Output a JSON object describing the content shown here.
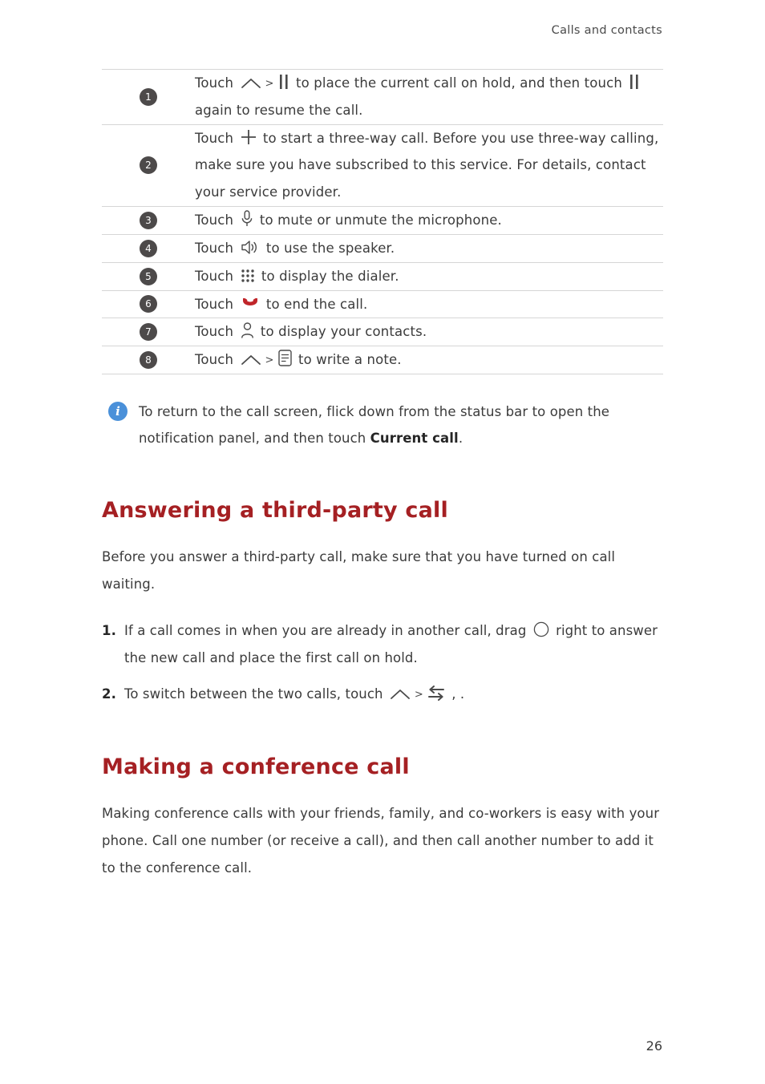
{
  "header": {
    "running_title": "Calls and contacts"
  },
  "table": {
    "rows": [
      {
        "num": "1",
        "seg": [
          {
            "t": "text",
            "v": "Touch "
          },
          {
            "t": "icon",
            "v": "chevron-up-icon"
          },
          {
            "t": "sep",
            "v": ">"
          },
          {
            "t": "icon",
            "v": "pause-icon"
          },
          {
            "t": "text",
            "v": " to place the current call on hold, and then touch "
          },
          {
            "t": "icon",
            "v": "pause-icon"
          },
          {
            "t": "text",
            "v": " again to resume the call."
          }
        ]
      },
      {
        "num": "2",
        "seg": [
          {
            "t": "text",
            "v": "Touch "
          },
          {
            "t": "icon",
            "v": "plus-icon"
          },
          {
            "t": "text",
            "v": " to start a three-way call. Before you use three-way calling, make sure you have subscribed to this service. For details, contact your service provider."
          }
        ]
      },
      {
        "num": "3",
        "seg": [
          {
            "t": "text",
            "v": "Touch "
          },
          {
            "t": "icon",
            "v": "microphone-icon"
          },
          {
            "t": "text",
            "v": " to mute or unmute the microphone."
          }
        ]
      },
      {
        "num": "4",
        "seg": [
          {
            "t": "text",
            "v": "Touch "
          },
          {
            "t": "icon",
            "v": "speaker-icon"
          },
          {
            "t": "text",
            "v": " to use the speaker."
          }
        ]
      },
      {
        "num": "5",
        "seg": [
          {
            "t": "text",
            "v": "Touch "
          },
          {
            "t": "icon",
            "v": "dialpad-icon"
          },
          {
            "t": "text",
            "v": " to display the dialer."
          }
        ]
      },
      {
        "num": "6",
        "seg": [
          {
            "t": "text",
            "v": "Touch "
          },
          {
            "t": "icon",
            "v": "end-call-icon"
          },
          {
            "t": "text",
            "v": " to end the call."
          }
        ]
      },
      {
        "num": "7",
        "seg": [
          {
            "t": "text",
            "v": "Touch "
          },
          {
            "t": "icon",
            "v": "contact-person-icon"
          },
          {
            "t": "text",
            "v": " to display your contacts."
          }
        ]
      },
      {
        "num": "8",
        "seg": [
          {
            "t": "text",
            "v": "Touch "
          },
          {
            "t": "icon",
            "v": "chevron-up-icon"
          },
          {
            "t": "sep",
            "v": ">"
          },
          {
            "t": "icon",
            "v": "note-icon"
          },
          {
            "t": "text",
            "v": " to write a note."
          }
        ]
      }
    ]
  },
  "note": {
    "icon": "info-icon",
    "icon_glyph": "i",
    "text_before": "To return to the call screen, flick down from the status bar to open the notification panel, and then touch ",
    "bold_text": "Current call",
    "text_after": "."
  },
  "sections": [
    {
      "heading": "Answering a third-party call",
      "paragraph": "Before you answer a third-party call, make sure that you have turned on call waiting.",
      "steps": [
        {
          "num": "1.",
          "seg": [
            {
              "t": "text",
              "v": "If a call comes in when you are already in another call, drag "
            },
            {
              "t": "icon",
              "v": "circle-handle-icon"
            },
            {
              "t": "text",
              "v": " right to answer the new call and place the first call on hold."
            }
          ]
        },
        {
          "num": "2.",
          "seg": [
            {
              "t": "text",
              "v": "To switch between the two calls, touch "
            },
            {
              "t": "icon",
              "v": "chevron-up-icon"
            },
            {
              "t": "sep",
              "v": ">"
            },
            {
              "t": "icon",
              "v": "swap-calls-icon"
            },
            {
              "t": "text",
              "v": " , ."
            }
          ]
        }
      ]
    },
    {
      "heading": "Making a conference call",
      "paragraph": "Making conference calls with your friends, family, and co-workers is easy with your phone. Call one number (or receive a call), and then call another number to add it to the conference call.",
      "steps": []
    }
  ],
  "footer": {
    "page_number": "26"
  },
  "colors": {
    "heading_red": "#a52023",
    "end_call_red": "#c0252a",
    "info_blue": "#4a90d9",
    "badge_gray": "#4d4a4a",
    "rule_gray": "#d6d6d6",
    "body_text": "#3b3b3b"
  }
}
